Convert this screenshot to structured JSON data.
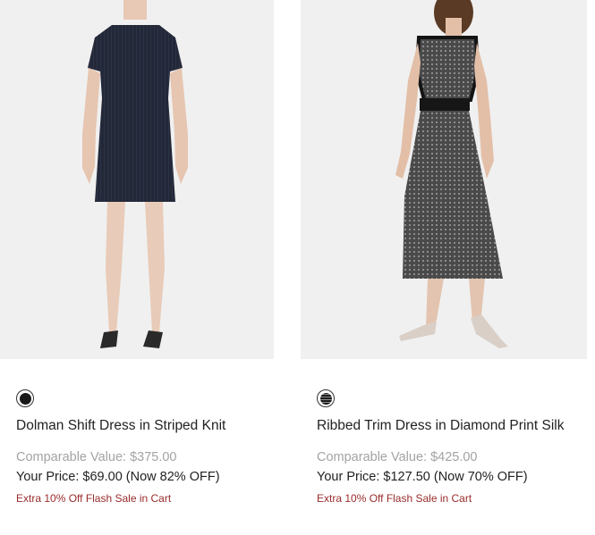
{
  "products": [
    {
      "name": "Dolman Shift Dress in Striped Knit",
      "swatch_color": "#1a1a1a",
      "comparable_value": "Comparable Value: $375.00",
      "your_price": "Your Price: $69.00 (Now 82% OFF)",
      "promo": "Extra 10% Off Flash Sale in Cart"
    },
    {
      "name": "Ribbed Trim Dress in Diamond Print Silk",
      "swatch_color": "#555555",
      "comparable_value": "Comparable Value: $425.00",
      "your_price": "Your Price: $127.50 (Now 70% OFF)",
      "promo": "Extra 10% Off Flash Sale in Cart"
    }
  ],
  "colors": {
    "image_background": "#f0f0f0",
    "comparable_text": "#a3a3a3",
    "promo_text": "#9b2b2b"
  }
}
